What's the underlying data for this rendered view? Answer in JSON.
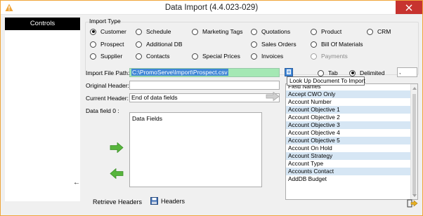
{
  "window": {
    "title": "Data Import (4.4.023-029)"
  },
  "left_panel": {
    "header": "Controls"
  },
  "import_type": {
    "label": "Import Type",
    "options": {
      "customer": "Customer",
      "schedule": "Schedule",
      "marketing_tags": "Marketing Tags",
      "quotations": "Quotations",
      "product": "Product",
      "crm": "CRM",
      "prospect": "Prospect",
      "additional_db": "Additional DB",
      "sales_orders": "Sales Orders",
      "bill_of_materials": "Bill Of Materials",
      "supplier": "Supplier",
      "contacts": "Contacts",
      "special_prices": "Special Prices",
      "invoices": "Invoices",
      "payments": "Payments"
    },
    "selected": "Customer"
  },
  "file": {
    "path_label": "Import File Path:",
    "path_value": "C:\\PromoServe\\Import\\Prospect.csv",
    "lookup_tooltip": "Look Up Document To Import",
    "tab_label": "Tab",
    "delimited_label": "Delimited",
    "delimiter_selected": "Delimited",
    "delimiter_char": ","
  },
  "headers": {
    "original_label": "Original Header:",
    "original_value": "",
    "current_label": "Current Header:",
    "current_value": "End of data fields",
    "datafield_label": "Data field 0 :",
    "datafields_header": "Data Fields"
  },
  "field_list": {
    "rows": [
      "Field Names",
      "Accept CWO Only",
      "Account Number",
      "Account Objective 1",
      "Account Objective 2",
      "Account Objective 3",
      "Account Objective 4",
      "Account Objective 5",
      "Account On Hold",
      "Account Strategy",
      "Account Type",
      "Accounts Contact",
      "AddDB Budget"
    ]
  },
  "bottom": {
    "retrieve_headers": "Retrieve Headers",
    "headers": "Headers"
  },
  "colors": {
    "accent_orange": "#f0a53a",
    "close_red": "#c7332f",
    "path_green": "#a4e8b4",
    "selection_blue": "#3f86d6",
    "list_alt": "#d6e6f4",
    "arrow_green": "#57b53c"
  },
  "icons": {
    "app": "warning-triangle-icon",
    "close": "close-icon",
    "lookup": "document-icon",
    "add": "right-arrow-icon",
    "remove": "left-arrow-icon",
    "move": "right-arrow-icon",
    "headers": "save-icon",
    "exit": "exit-icon"
  }
}
